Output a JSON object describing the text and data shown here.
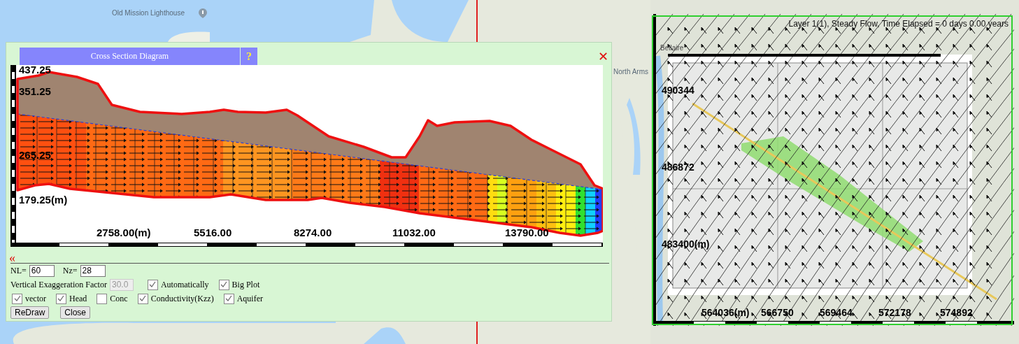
{
  "map": {
    "labels": [
      {
        "text": "Old Mission Lighthouse"
      },
      {
        "text": "North Arms"
      }
    ]
  },
  "dialog": {
    "title": "Cross Section Diagram",
    "help": "?",
    "close": "✕",
    "collapse": "«",
    "cross_section": {
      "y_labels": [
        "437.25",
        "351.25",
        "265.25",
        "179.25(m)"
      ],
      "x_labels": [
        "2758.00(m)",
        "5516.00",
        "8274.00",
        "11032.00",
        "13790.00"
      ]
    },
    "nl": {
      "label": "NL=",
      "value": "60"
    },
    "nz": {
      "label": "Nz=",
      "value": "28"
    },
    "exaggeration": {
      "label": "Vertical Exaggeration Factor",
      "value": "30.0",
      "disabled": true
    },
    "options_row_1": [
      {
        "label": "Automatically",
        "checked": true
      },
      {
        "label": "Big Plot",
        "checked": true
      }
    ],
    "options_row_2": [
      {
        "label": "vector",
        "checked": true
      },
      {
        "label": "Head",
        "checked": true
      },
      {
        "label": "Conc",
        "checked": false
      },
      {
        "label": "Conductivity(Kzz)",
        "checked": true
      },
      {
        "label": "Aquifer",
        "checked": true
      }
    ],
    "buttons": [
      "ReDraw",
      "Close"
    ]
  },
  "plan_view": {
    "title": "Layer 1(1), Steady Flow, Time Elapsed = 0 days 0.00 years",
    "place_label": "Bellaire",
    "y_labels": [
      "490344",
      "486872",
      "483400(m)"
    ],
    "x_labels": [
      "564036(m)",
      "566750",
      "569464",
      "572178",
      "574892"
    ]
  }
}
